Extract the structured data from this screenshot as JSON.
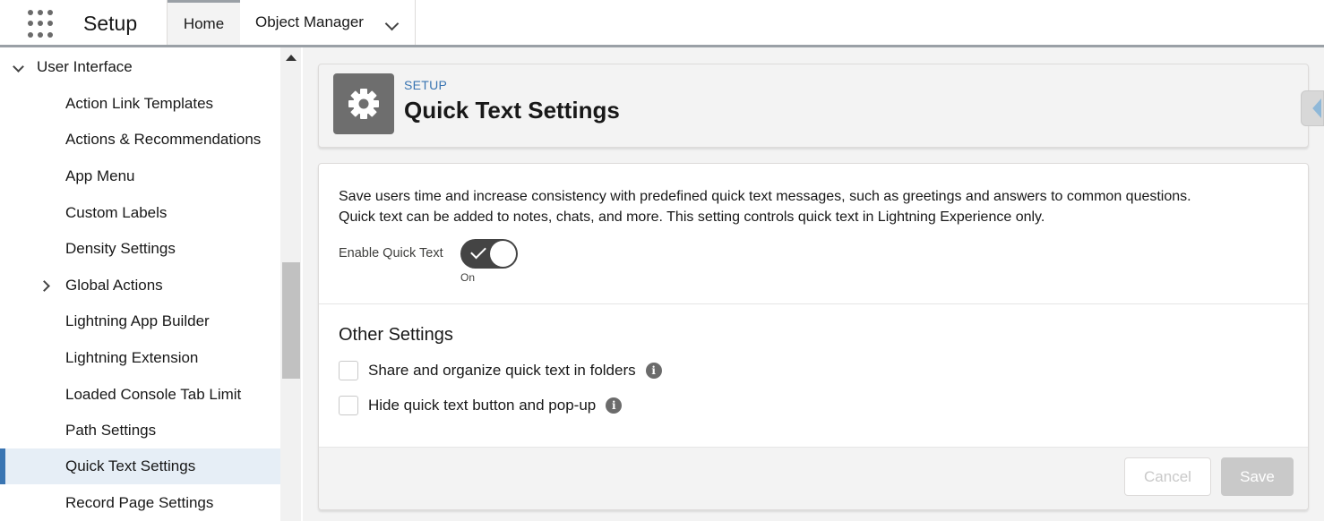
{
  "topbar": {
    "app_name": "Setup",
    "tabs": [
      {
        "label": "Home",
        "active": true
      },
      {
        "label": "Object Manager",
        "active": false
      }
    ]
  },
  "sidebar": {
    "parent": {
      "label": "User Interface",
      "expanded": true
    },
    "items": [
      {
        "label": "Action Link Templates"
      },
      {
        "label": "Actions & Recommendations"
      },
      {
        "label": "App Menu"
      },
      {
        "label": "Custom Labels"
      },
      {
        "label": "Density Settings"
      },
      {
        "label": "Global Actions",
        "expandable": true
      },
      {
        "label": "Lightning App Builder"
      },
      {
        "label": "Lightning Extension"
      },
      {
        "label": "Loaded Console Tab Limit"
      },
      {
        "label": "Path Settings"
      },
      {
        "label": "Quick Text Settings",
        "selected": true
      },
      {
        "label": "Record Page Settings"
      }
    ]
  },
  "header": {
    "eyebrow": "SETUP",
    "title": "Quick Text Settings",
    "icon": "gear-icon"
  },
  "content": {
    "description_line1": "Save users time and increase consistency with predefined quick text messages, such as greetings and answers to common questions.",
    "description_line2": "Quick text can be added to notes, chats, and more. This setting controls quick text in Lightning Experience only.",
    "toggle_label": "Enable Quick Text",
    "toggle_state": "On",
    "toggle_on": true,
    "other_settings_title": "Other Settings",
    "options": [
      {
        "label": "Share and organize quick text in folders",
        "checked": false
      },
      {
        "label": "Hide quick text button and pop-up",
        "checked": false
      }
    ]
  },
  "footer": {
    "cancel_label": "Cancel",
    "save_label": "Save"
  },
  "colors": {
    "accent": "#3a75b2",
    "selected_bg": "#e6eef6",
    "toggle_bg": "#444444",
    "disabled_button": "#c9c9c9"
  }
}
